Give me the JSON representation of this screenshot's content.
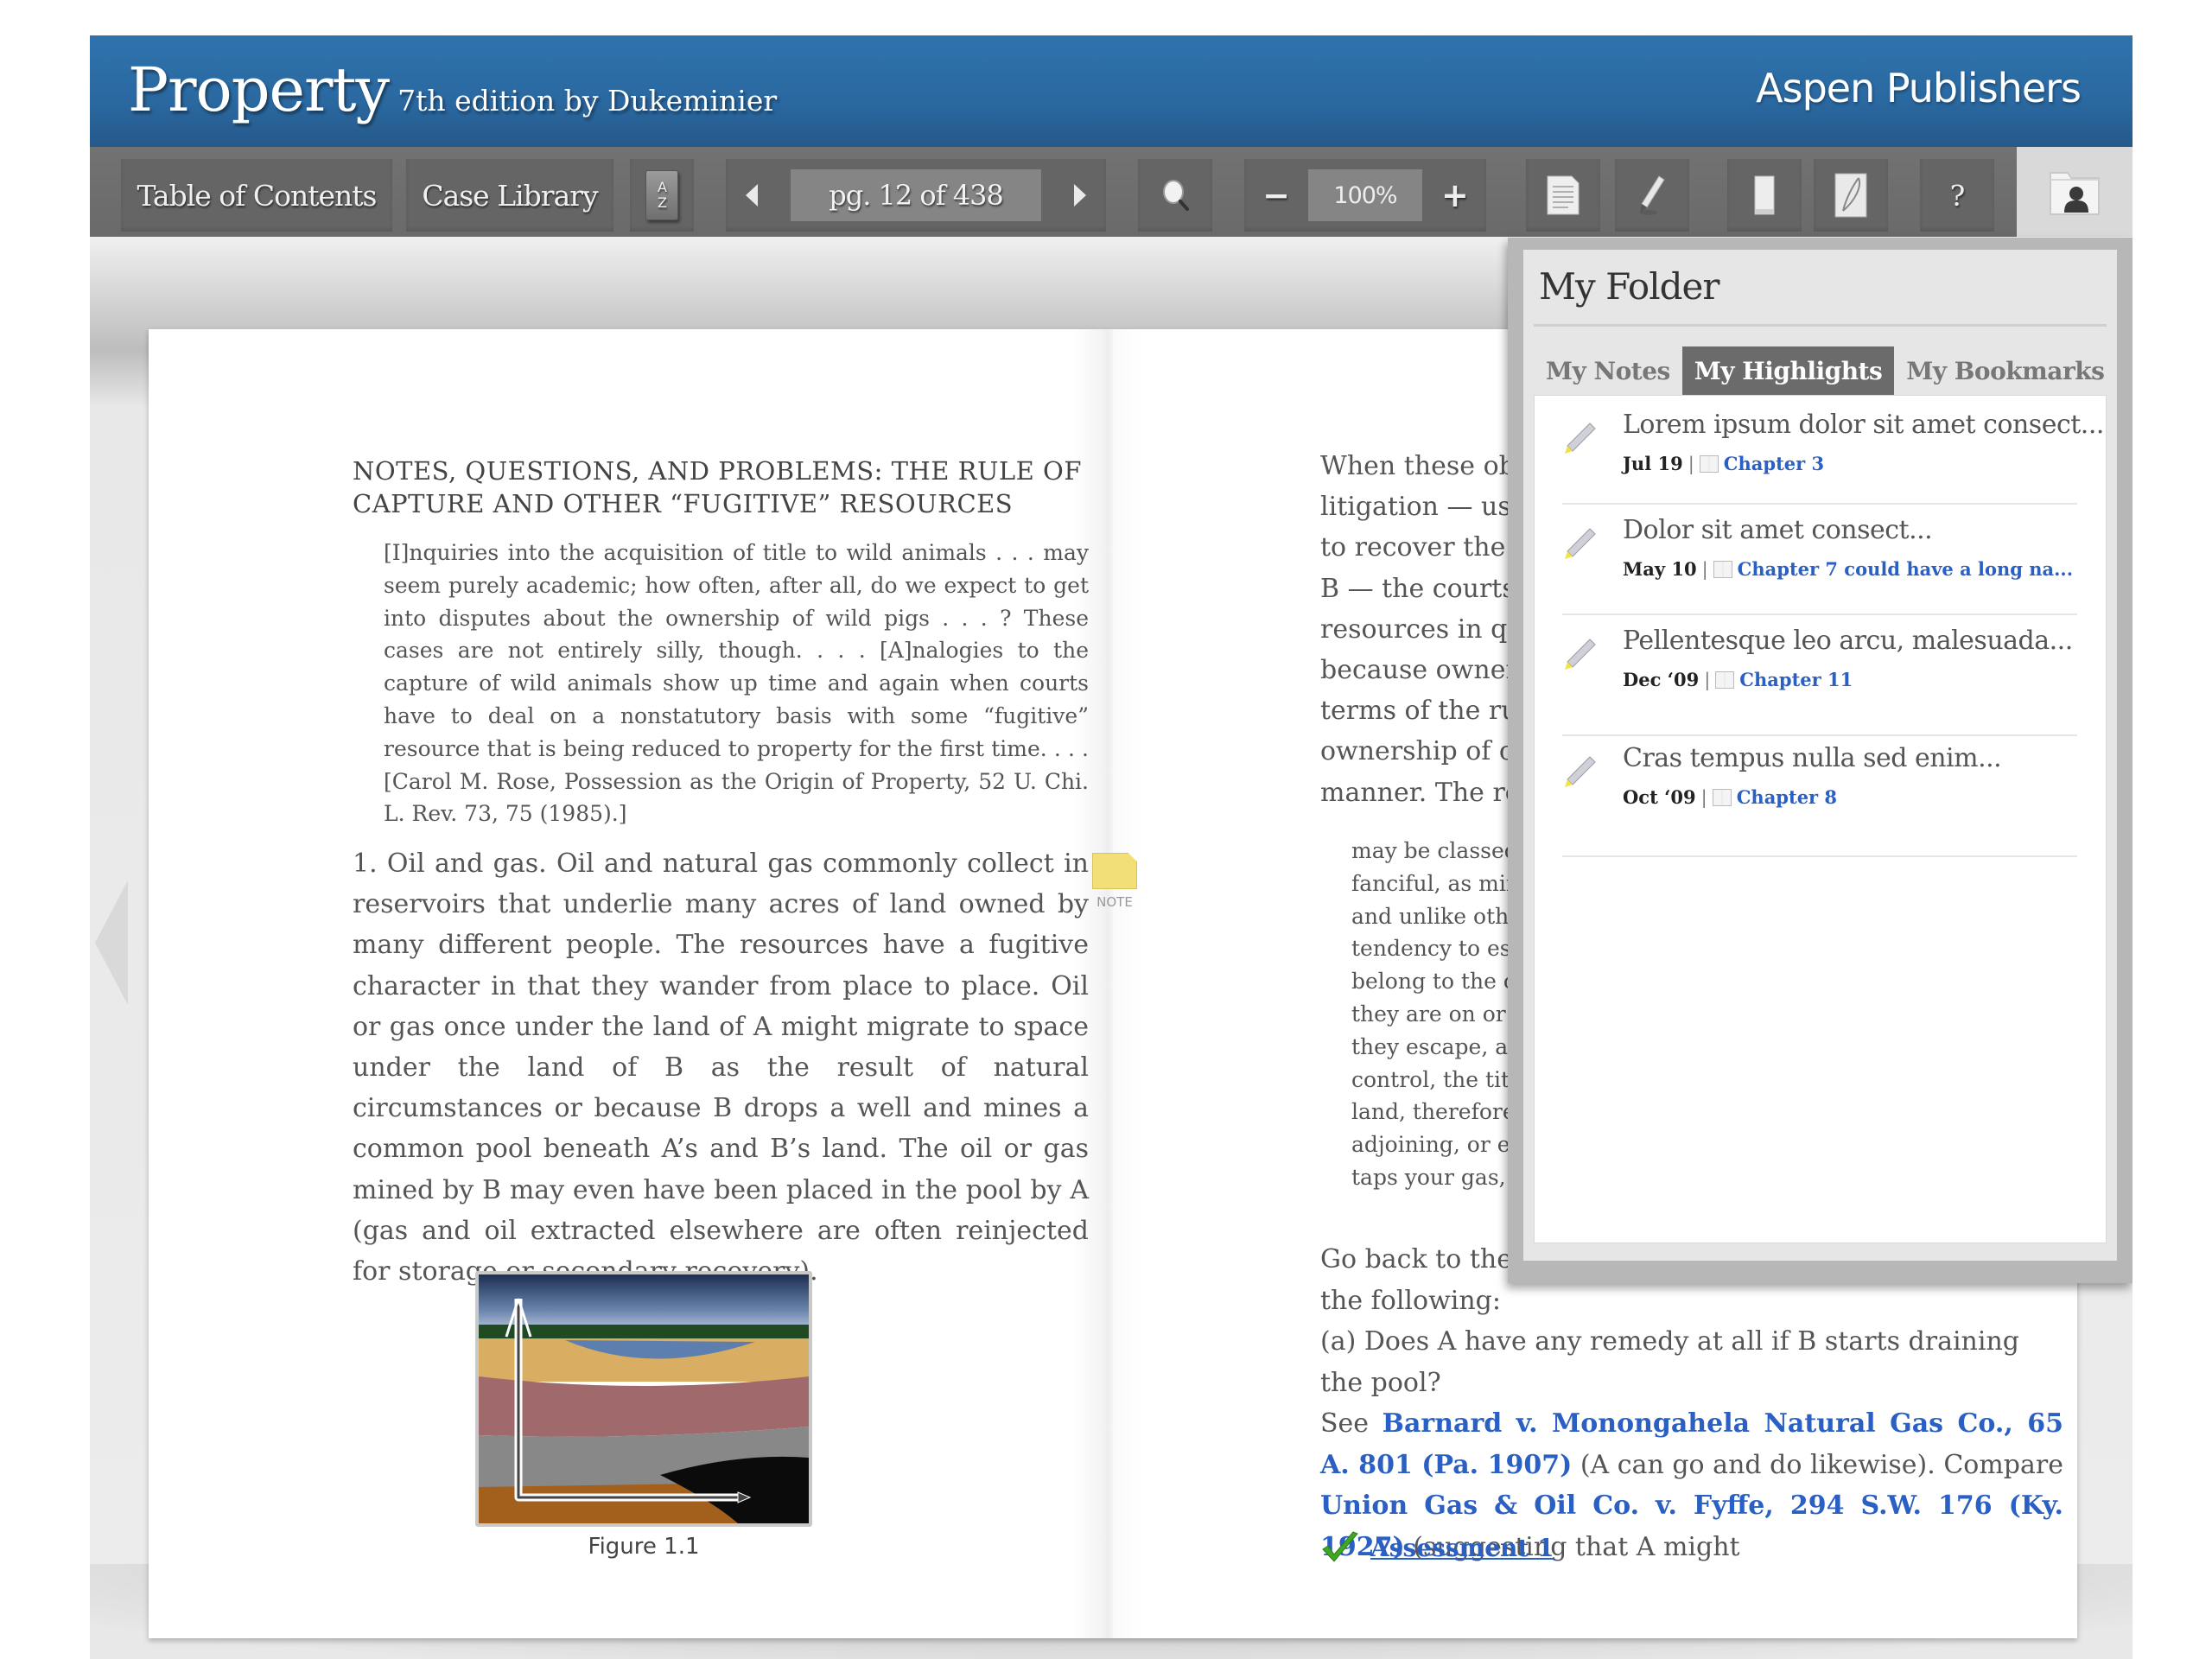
{
  "header": {
    "title": "Property",
    "subtitle": "7th edition by Dukeminier",
    "publisher": "Aspen Publishers"
  },
  "toolbar": {
    "table_of_contents": "Table of Contents",
    "case_library": "Case Library",
    "az_index": {
      "top": "A",
      "bottom": "Z"
    },
    "page_indicator": "pg. 12 of 438",
    "zoom_level": "100%",
    "zoom_out": "−",
    "zoom_in": "+",
    "help": "?",
    "icons": [
      "az-index-icon",
      "prev-page-icon",
      "next-page-icon",
      "search-icon",
      "notes-icon",
      "highlighter-icon",
      "bookmark-icon",
      "quill-icon",
      "help-icon",
      "my-folder-icon"
    ]
  },
  "left_page": {
    "heading": "NOTES, QUESTIONS, AND PROBLEMS: THE RULE OF CAPTURE AND OTHER “FUGITIVE” RESOURCES",
    "quote": "[I]nquiries into the acquisition of title to wild animals . . . may seem purely academic; how often, after all, do we expect to get into disputes about the ownership of wild pigs . . . ? These cases are not entirely silly, though. . . . [A]nalogies to the capture of wild animals show up time and again when courts have to deal on a nonstatutory basis with some “fugitive” resource that is being reduced to property for the first time. . . . [Carol M. Rose, Possession as the Origin of Property, 52 U. Chi. L. Rev. 73, 75 (1985).]",
    "paragraph": "1. Oil and gas. Oil and natural gas commonly collect in reservoirs that underlie many acres of land owned by many different people. The resources have a fugitive character in that they wander from place to place. Oil or gas once under the land of A might migrate to space under the land of B as the result of natural circumstances or because B drops a well and mines a common pool beneath A’s and B’s land. The oil or gas mined by B may even have been placed in the pool by A (gas and oil extracted elsewhere are often reinjected for storage or secondary recovery).",
    "note_label": "NOTE",
    "figure_caption": "Figure 1.1"
  },
  "right_page": {
    "paragraph1_lines": [
      "When these obviously",
      "litigation — usually (bu",
      "to recover the value of",
      "B — the courts were",
      "resources in question",
      "because ownership of",
      "terms of the rule of",
      "ownership of oil and g",
      "manner. The resources"
    ],
    "quote_lines": [
      "may be classed by th",
      "fanciful, as minerals f",
      "and unlike other mi",
      "tendency to escape wit",
      "belong to the owner o",
      "they are on or in it, a",
      "they escape, and go in",
      "control, the title of the",
      "land, therefore, is not",
      "adjoining, or even a d",
      "taps your gas, so that i"
    ],
    "para2_line1": "Go back to the example",
    "para2_line2": "the following:",
    "question_a": "(a) Does A have any remedy at all if B starts draining the pool?",
    "see": "See ",
    "case1": "Barnard v. Monongahela Natural Gas Co., 65 A. 801 (Pa. 1907)",
    "mid_text": " (A can go and do likewise). Compare ",
    "case2": "Union Gas & Oil Co. v. Fyffe, 294 S.W. 176 (Ky. 1927)",
    "end_text": " (suggesting that A might",
    "assessment": "Assessment 1"
  },
  "folder": {
    "title": "My Folder",
    "tabs": [
      {
        "label": "My Notes",
        "active": false
      },
      {
        "label": "My Highlights",
        "active": true
      },
      {
        "label": "My Bookmarks",
        "active": false
      }
    ],
    "items": [
      {
        "text": "Lorem ipsum dolor sit amet consect...",
        "date": "Jul 19",
        "chapter": "Chapter 3"
      },
      {
        "text": "Dolor sit amet consect...",
        "date": "May 10",
        "chapter": "Chapter 7  could have a long na..."
      },
      {
        "text": "Pellentesque leo arcu, malesuada...",
        "date": "Dec ‘09",
        "chapter": "Chapter 11"
      },
      {
        "text": "Cras tempus nulla sed enim...",
        "date": "Oct ‘09",
        "chapter": "Chapter 8"
      }
    ]
  },
  "colors": {
    "header_blue": "#2a6aa3",
    "toolbar_gray": "#6b6b6b",
    "link_blue": "#2a5fc4",
    "active_tab": "#6b6b6b"
  }
}
